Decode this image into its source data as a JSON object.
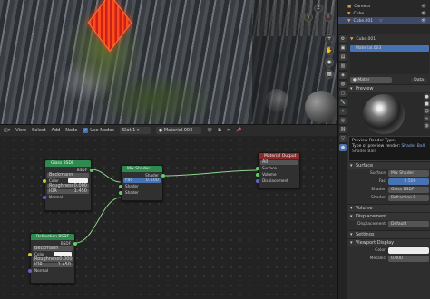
{
  "node_header": {
    "menu": [
      "View",
      "Select",
      "Add",
      "Node"
    ],
    "use_nodes_label": "Use Nodes",
    "slot": "Slot 1",
    "material": "Material.003"
  },
  "nodes": {
    "glass": {
      "title": "Glass BSDF",
      "output": "BSDF",
      "distribution": "Beckmann",
      "color_label": "Color",
      "roughness_label": "Roughness",
      "roughness": "0.000",
      "ior_label": "IOR",
      "ior": "1.450",
      "normal_label": "Normal"
    },
    "mix": {
      "title": "Mix Shader",
      "output": "Shader",
      "fac_label": "Fac",
      "fac": "0.500",
      "shader1": "Shader",
      "shader2": "Shader"
    },
    "output": {
      "title": "Material Output",
      "target": "All",
      "surface": "Surface",
      "volume": "Volume",
      "displacement": "Displacement"
    },
    "refraction": {
      "title": "Refraction BSDF",
      "output": "BSDF",
      "distribution": "Beckmann",
      "color_label": "Color",
      "roughness_label": "Roughness",
      "roughness": "0.000",
      "ior_label": "IOR",
      "ior": "1.450",
      "normal_label": "Normal"
    }
  },
  "outliner": {
    "items": [
      "Camera",
      "Cube",
      "Cube.001"
    ]
  },
  "properties": {
    "object_name": "Cube.001",
    "material_slot": "Material.003",
    "material_field": "Mater",
    "data_label": "Data",
    "preview_header": "Preview",
    "tooltip": {
      "line1": "Preview Render Type.",
      "line2_prefix": "Type of preview render:",
      "line2_value": "Shader Ball",
      "line3": "Shader Ball"
    },
    "surface_header": "Surface",
    "surface_label": "Surface",
    "surface_value": "Mix Shader",
    "fac_label": "Fac",
    "fac_value": "0.500",
    "shader1_label": "Shader",
    "shader1_value": "Glass BSDF",
    "shader2_label": "Shader",
    "shader2_value": "Refraction B...",
    "volume_header": "Volume",
    "displacement_header": "Displacement",
    "displacement_label": "Displacement",
    "displacement_value": "Default",
    "settings_header": "Settings",
    "viewport_display_header": "Viewport Display",
    "color_label": "Color",
    "metallic_label": "Metallic",
    "metallic_value": "0.000"
  },
  "colors": {
    "shader_node_header": "#2e8a4f",
    "output_node_header": "#8a2a2a",
    "selection": "#4772b3"
  }
}
